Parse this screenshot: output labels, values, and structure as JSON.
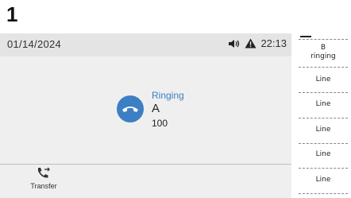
{
  "step": "1",
  "status_bar": {
    "date": "01/14/2024",
    "time": "22:13",
    "icons": [
      "speaker-volume-icon",
      "warning-icon"
    ]
  },
  "call": {
    "status": "Ringing",
    "name": "A",
    "number": "100",
    "icon": "handset-hangup-icon",
    "accent_color": "#3d7fc4"
  },
  "softkeys": [
    {
      "label": "Transfer",
      "icon": "call-transfer-icon"
    }
  ],
  "line_keys": [
    {
      "label_line1": "B",
      "label_line2": "ringing"
    },
    {
      "label_line1": "Line"
    },
    {
      "label_line1": "Line"
    },
    {
      "label_line1": "Line"
    },
    {
      "label_line1": "Line"
    },
    {
      "label_line1": "Line"
    }
  ]
}
